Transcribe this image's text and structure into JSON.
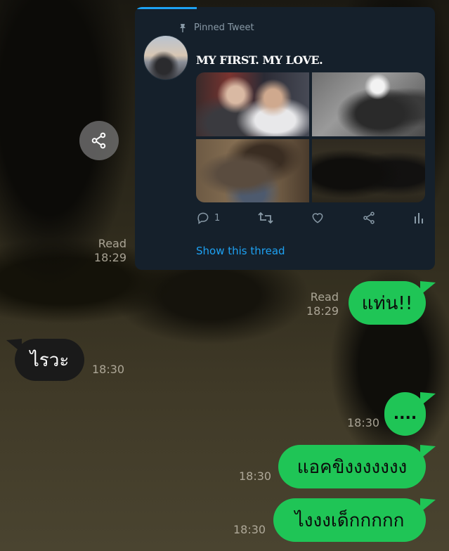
{
  "tweet": {
    "pinned_label": "Pinned Tweet",
    "title": "MY FIRST. MY LOVE.",
    "reply_count": "1",
    "show_thread": "Show this thread"
  },
  "messages": [
    {
      "id": "m1",
      "direction": "out",
      "text": "แท่น!!",
      "status": "Read",
      "time": "18:29"
    },
    {
      "id": "m2",
      "direction": "in",
      "text": "ไรวะ",
      "time": "18:30"
    },
    {
      "id": "m3",
      "direction": "out",
      "text": "....",
      "time": "18:30"
    },
    {
      "id": "m4",
      "direction": "out",
      "text": "แอคขิงงงงงงง",
      "time": "18:30"
    },
    {
      "id": "m5",
      "direction": "out",
      "text": "ไงงงเด็กกกกก",
      "time": "18:30"
    }
  ],
  "shared_post_meta": {
    "status": "Read",
    "time": "18:29"
  },
  "colors": {
    "bubble_out": "#1fc556",
    "bubble_in": "#1a1a1a",
    "tweet_bg": "#15202b",
    "link": "#1da1f2"
  }
}
